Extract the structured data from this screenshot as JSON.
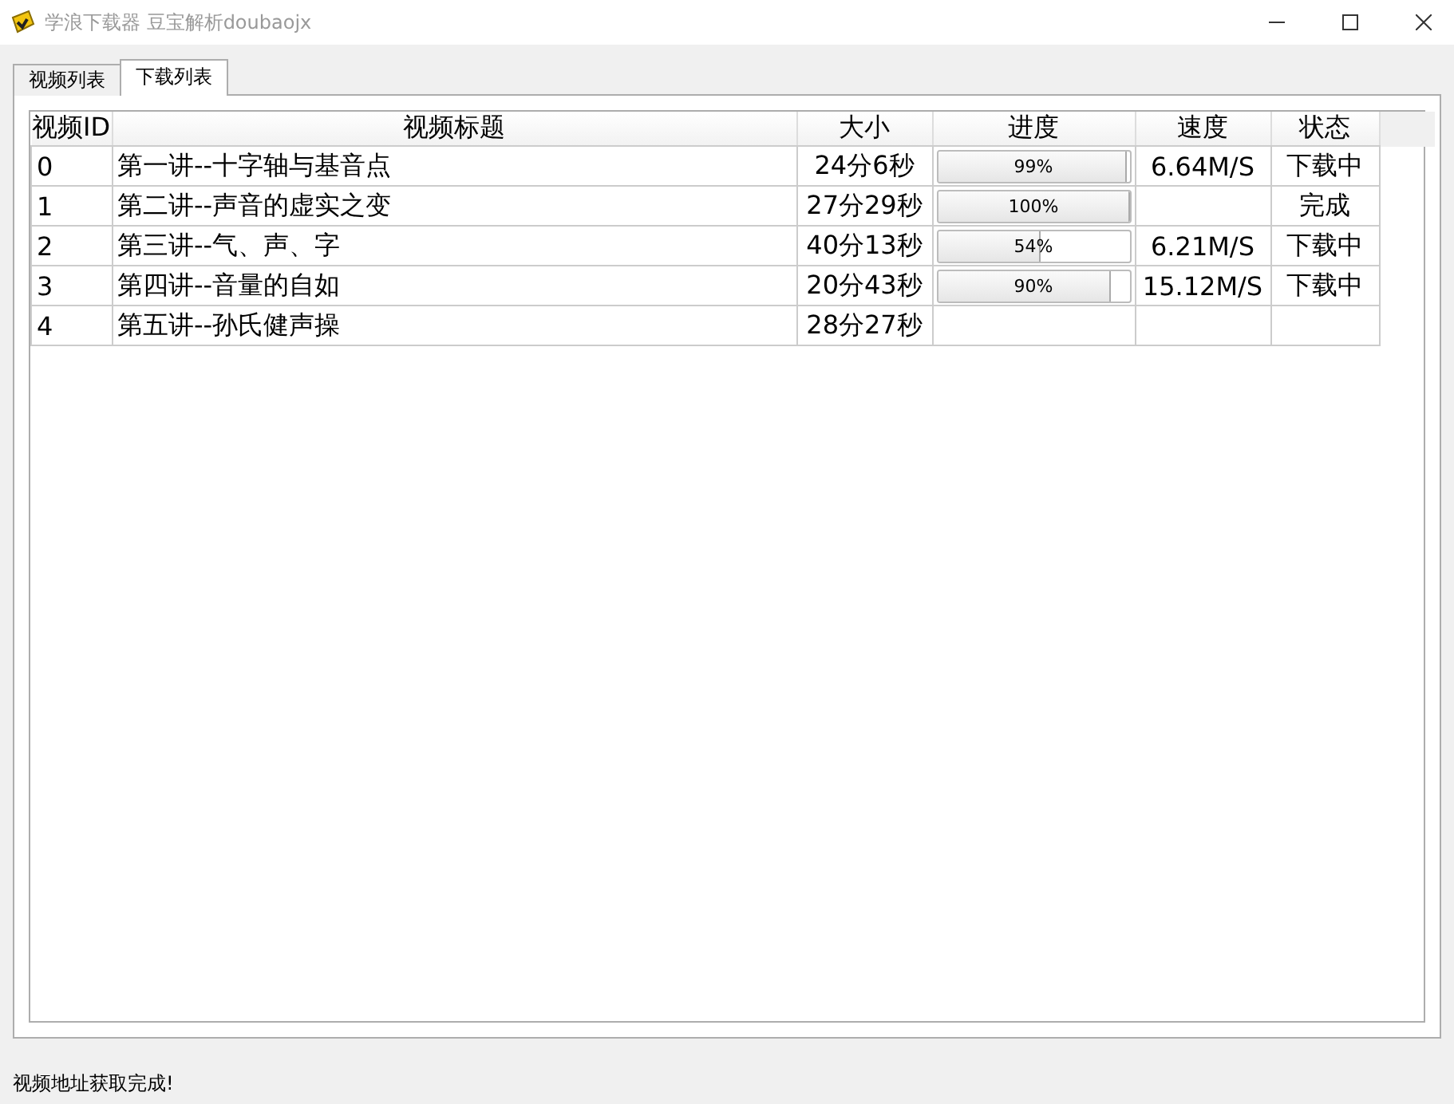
{
  "window": {
    "title": "学浪下载器 豆宝解析doubaojx"
  },
  "tabs": [
    {
      "label": "视频列表",
      "selected": false
    },
    {
      "label": "下载列表",
      "selected": true
    }
  ],
  "table": {
    "columns": [
      "视频ID",
      "视频标题",
      "大小",
      "进度",
      "速度",
      "状态"
    ],
    "rows": [
      {
        "id": "0",
        "title": "第一讲--十字轴与基音点",
        "size": "24分6秒",
        "progress": {
          "text": "99%",
          "level": 0.99
        },
        "speed": "6.64M/S",
        "status": "下载中"
      },
      {
        "id": "1",
        "title": "第二讲--声音的虚实之变",
        "size": "27分29秒",
        "progress": {
          "text": "100%",
          "level": 1
        },
        "speed": "",
        "status": "完成"
      },
      {
        "id": "2",
        "title": "第三讲--气、声、字",
        "size": "40分13秒",
        "progress": {
          "text": "54%",
          "level": 0.54
        },
        "speed": "6.21M/S",
        "status": "下载中"
      },
      {
        "id": "3",
        "title": "第四讲--音量的自如",
        "size": "20分43秒",
        "progress": {
          "text": "90%",
          "level": 0.9
        },
        "speed": "15.12M/S",
        "status": "下载中"
      },
      {
        "id": "4",
        "title": "第五讲--孙氏健声操",
        "size": "28分27秒"
      }
    ]
  },
  "status_bar": "视频地址获取完成!"
}
